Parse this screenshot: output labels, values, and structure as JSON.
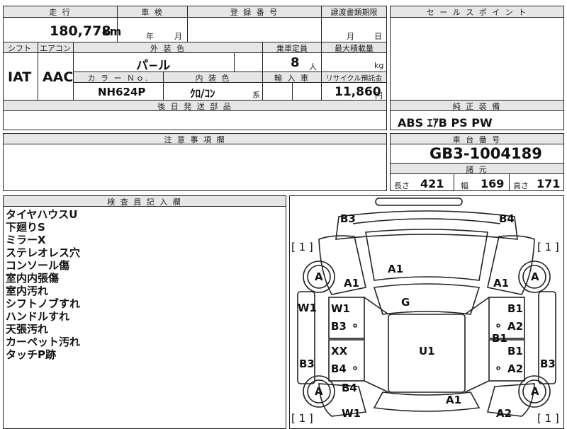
{
  "top_table": {
    "mileage": {
      "header": "走 行",
      "value": "180,778",
      "unit": "km"
    },
    "inspection": {
      "header": "車 検",
      "year_unit": "年",
      "month_unit": "月"
    },
    "registration": {
      "header": "登 録 番 号",
      "value": ""
    },
    "transfer_deadline": {
      "header": "譲渡書類期限",
      "month_unit": "月",
      "day_unit": "日"
    },
    "shift": {
      "header": "シフト",
      "value": "IAT"
    },
    "aircon": {
      "header": "エアコン",
      "value": "AAC"
    },
    "exterior_color": {
      "header": "外 装 色",
      "value": "パ−ル"
    },
    "capacity": {
      "header": "乗車定員",
      "value": "8",
      "unit": "人"
    },
    "max_load": {
      "header": "最大積載量",
      "unit": "kg"
    },
    "color_no": {
      "header": "カ ラ ー Ｎｏ.",
      "value": "NH624P"
    },
    "interior_color": {
      "header": "内 装 色",
      "value": "ｸﾛ/ｺﾝ",
      "suffix": "系"
    },
    "import": {
      "header": "輸 入 車"
    },
    "recycle": {
      "header": "リサイクル預託金",
      "value": "11,860",
      "unit": "円"
    },
    "later_parts": {
      "header": "後 日 発 送 部 品"
    }
  },
  "sales_point": {
    "header": "セ ー ル ス ポ イ ン ト"
  },
  "equipment": {
    "header": "純 正 装 備",
    "value": "ABS ｴｱB PS PW"
  },
  "notes": {
    "header": "注 意 事 項 欄"
  },
  "chassis": {
    "header": "車 台 番 号",
    "value": "GB3-1004189"
  },
  "specs": {
    "header": "諸 元",
    "length_label": "長さ",
    "length": "421",
    "width_label": "幅",
    "width": "169",
    "height_label": "高さ",
    "height": "171"
  },
  "inspector": {
    "header": "検 査 員 記 入 欄",
    "items": [
      "タイヤハウスU",
      "下廻りS",
      "ミラーX",
      "ステレオレス穴",
      "コンソール傷",
      "室内内張傷",
      "室内汚れ",
      "シフトノブすれ",
      "ハンドルすれ",
      "天張汚れ",
      "カーペット汚れ",
      "タッチP跡"
    ]
  },
  "diagram": {
    "marks": {
      "b3_top_left": "B3",
      "b4_top_right": "B4",
      "bracket_tl": "[ 1 ]",
      "bracket_tr": "[ 1 ]",
      "bracket_bl": "[ 1 ]",
      "bracket_br": "[ 1 ]",
      "tire_fl": "A",
      "tire_fr": "A",
      "tire_rl": "A",
      "tire_rr": "A",
      "hood_a1": "A1",
      "fender_l_a1": "A1",
      "fender_r_a1": "A1",
      "windshield_g": "G",
      "side_l_w1": "W1",
      "door_fl_w1": "W1",
      "door_fl_b3": "B3",
      "door_fr_b1": "B1",
      "door_fr_a2": "A2",
      "pillar_r_b1": "B1",
      "roof_u1": "U1",
      "door_rl_xx": "XX",
      "door_rl_b4": "B4",
      "door_rr_b1": "B1",
      "door_rr_a2": "A2",
      "side_l_b3": "B3",
      "side_r_b3": "B3",
      "rear_l_b4": "B4",
      "rear_a1": "A1",
      "rear_l_w1": "W1",
      "rear_r_a2": "A2"
    }
  }
}
